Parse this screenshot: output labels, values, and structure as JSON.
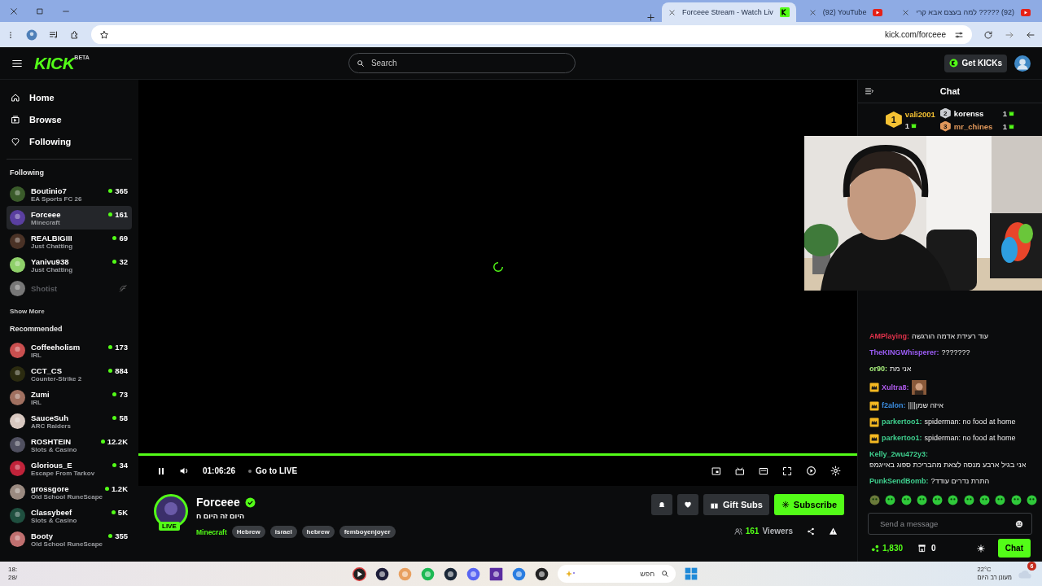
{
  "browser": {
    "tabs": [
      {
        "title": "Forceee Stream - Watch Liv",
        "selected": true
      },
      {
        "title": "(92) YouTube",
        "selected": false
      },
      {
        "title": "(92) ????? למה בעצם אבא קרי",
        "selected": false
      }
    ],
    "address": "kick.com/forceee"
  },
  "header": {
    "logo": "KICK",
    "logo_badge": "BETA",
    "search_placeholder": "Search",
    "kicks_button": "Get KICKs"
  },
  "sidebar": {
    "nav": [
      {
        "label": "Home",
        "kind": "home"
      },
      {
        "label": "Browse",
        "kind": "browse"
      },
      {
        "label": "Following",
        "kind": "following"
      }
    ],
    "following_heading": "Following",
    "following": [
      {
        "name": "Boutinio7",
        "category": "EA Sports FC 26",
        "viewers": "365",
        "live": true,
        "selected": false
      },
      {
        "name": "Forceee",
        "category": "Minecraft",
        "viewers": "161",
        "live": true,
        "selected": true
      },
      {
        "name": "REALBIGIII",
        "category": "Just Chatting",
        "viewers": "69",
        "live": true,
        "selected": false
      },
      {
        "name": "Yanivu938",
        "category": "Just Chatting",
        "viewers": "32",
        "live": true,
        "selected": false
      },
      {
        "name": "Shotist",
        "live": false,
        "selected": false
      }
    ],
    "show_more": "Show More",
    "recommended_heading": "Recommended",
    "recommended": [
      {
        "name": "Coffeeholism",
        "category": "IRL",
        "viewers": "173"
      },
      {
        "name": "CCT_CS",
        "category": "Counter-Strike 2",
        "viewers": "884"
      },
      {
        "name": "Zumi",
        "category": "IRL",
        "viewers": "73"
      },
      {
        "name": "SauceSuh",
        "category": "ARC Raiders",
        "viewers": "58"
      },
      {
        "name": "ROSHTEIN",
        "category": "Slots & Casino",
        "viewers": "12.2K"
      },
      {
        "name": "Glorious_E",
        "category": "Escape From Tarkov",
        "viewers": "34"
      },
      {
        "name": "grossgore",
        "category": "Old School RuneScape",
        "viewers": "1.2K"
      },
      {
        "name": "Classybeef",
        "category": "Slots & Casino",
        "viewers": "5K"
      },
      {
        "name": "Booty",
        "category": "Old School RuneScape",
        "viewers": "355"
      }
    ]
  },
  "player": {
    "progress": {
      "level": 1
    },
    "time": "01:06:26",
    "go_live": "Go to LIVE"
  },
  "stream": {
    "name": "Forceee",
    "verified": true,
    "live_badge": "LIVE",
    "title": "היום זה היום ח",
    "category": "Minecraft",
    "tags": [
      "Hebrew",
      "israel",
      "hebrew",
      "femboyenjoyer"
    ],
    "gift_button": "Gift Subs",
    "subscribe_button": "Subscribe",
    "viewers": "161",
    "viewers_label": "Viewers"
  },
  "chat": {
    "title": "Chat",
    "leaderboard": [
      {
        "rank": "1",
        "name": "vali2001",
        "count": "1",
        "color": "#f5c233"
      },
      {
        "rank": "2",
        "name": "korenss",
        "count": "1",
        "color": "#c9ccd1"
      },
      {
        "rank": "3",
        "name": "mr_chines",
        "count": "1",
        "color": "#e0975a"
      }
    ],
    "messages": [
      {
        "user": "AMPlaying:",
        "color": "#e0324b",
        "text": "עוד רעידת אדמה הורגשה",
        "crown": false
      },
      {
        "user": "TheKINGWhisperer:",
        "color": "#9b5cf5",
        "text": "???????",
        "crown": false
      },
      {
        "user": "or90:",
        "color": "#a8f07c",
        "text": "אני מת",
        "crown": false
      },
      {
        "user": "Xultra8:",
        "color": "#b25cf0",
        "kind": "emote",
        "crown": true
      },
      {
        "user": "f2alon:",
        "color": "#3b8de0",
        "text": "איזה שמן||||",
        "crown": true
      },
      {
        "user": "parkertoo1:",
        "color": "#3fcf8e",
        "text": "spiderman: no food at home",
        "crown": true
      },
      {
        "user": "parkertoo1:",
        "color": "#3fcf8e",
        "text": "spiderman: no food at home",
        "crown": true
      },
      {
        "user": "Kelly_2wu472y3:",
        "color": "#3fcf8e",
        "text": "אני בגיל ארבע מנסה לצאת מהבריכת ספוג באייגמפ",
        "crown": false
      },
      {
        "user": "PunkSendBomb:",
        "color": "#3fcf8e",
        "text": "התרת נדרים עודד?",
        "crown": false
      }
    ],
    "placeholder": "Send a message",
    "points": "1,830",
    "gifts": "0",
    "send_button": "Chat"
  },
  "taskbar": {
    "clock": [
      "18:",
      "28/"
    ],
    "search_placeholder": "חפש",
    "temperature": "22°C",
    "weather": "מעונן רב היום",
    "notifications": "6"
  }
}
